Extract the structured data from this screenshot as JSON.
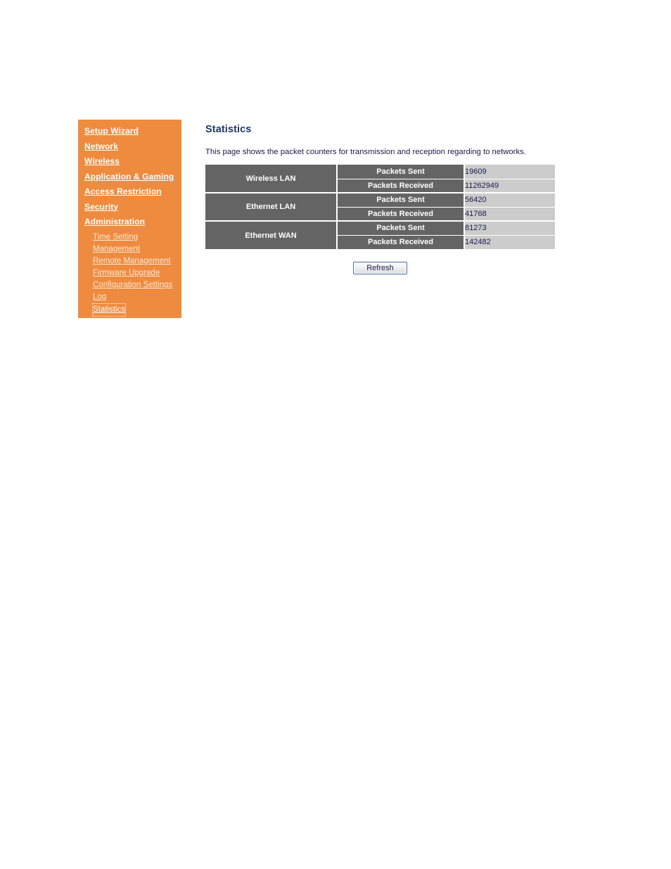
{
  "sidebar": {
    "main_items": [
      {
        "label": "Setup Wizard"
      },
      {
        "label": "Network"
      },
      {
        "label": "Wireless"
      },
      {
        "label": "Application & Gaming"
      },
      {
        "label": "Access Restriction"
      },
      {
        "label": "Security"
      },
      {
        "label": "Administration"
      }
    ],
    "sub_items": [
      {
        "label": "Time Setting",
        "selected": false
      },
      {
        "label": "Management",
        "selected": false
      },
      {
        "label": "Remote Management",
        "selected": false
      },
      {
        "label": "Firmware Upgrade",
        "selected": false
      },
      {
        "label": "Configuration Settings",
        "selected": false
      },
      {
        "label": "Log",
        "selected": false
      },
      {
        "label": "Statistics",
        "selected": true
      }
    ],
    "background_color": "#ef8b3e",
    "text_color": "#ffffff",
    "sub_text_color": "#fbe9d9"
  },
  "main": {
    "title": "Statistics",
    "title_color": "#1f3864",
    "description": "This page shows the packet counters for transmission and reception regarding to networks.",
    "table": {
      "header_bg_color": "#646464",
      "value_bg_color": "#cccccc",
      "groups": [
        {
          "interface": "Wireless LAN",
          "rows": [
            {
              "label": "Packets Sent",
              "value": "19609"
            },
            {
              "label": "Packets Received",
              "value": "11262949"
            }
          ]
        },
        {
          "interface": "Ethernet LAN",
          "rows": [
            {
              "label": "Packets Sent",
              "value": "56420"
            },
            {
              "label": "Packets Received",
              "value": "41768"
            }
          ]
        },
        {
          "interface": "Ethernet WAN",
          "rows": [
            {
              "label": "Packets Sent",
              "value": "81273"
            },
            {
              "label": "Packets Received",
              "value": "142482"
            }
          ]
        }
      ]
    },
    "refresh_button_label": "Refresh"
  }
}
